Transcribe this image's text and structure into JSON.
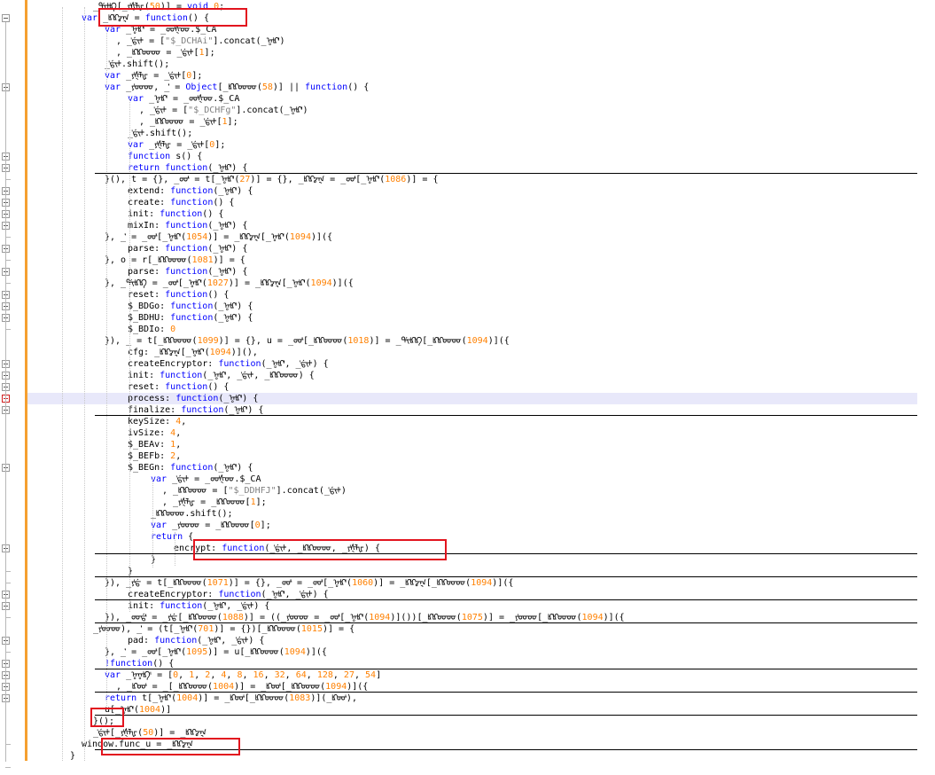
{
  "colors": {
    "keyword": "#0000ff",
    "number": "#ff8000",
    "string": "#808080",
    "default": "#000000",
    "change_margin": "#f5a030",
    "highlight_box": "#e2141e",
    "current_line": "#e8e8fa"
  },
  "code_lines": [
    {
      "indent": 5,
      "segs": [
        [
          "def",
          "_ᡩᡳᡰᡌ[_ᠶᡃᡧᡀ("
        ],
        [
          "num",
          "50"
        ],
        [
          "def",
          ")] = "
        ],
        [
          "kw",
          "void"
        ],
        [
          "def",
          " "
        ],
        [
          "num",
          "0"
        ],
        [
          "def",
          ";"
        ]
      ]
    },
    {
      "indent": 4,
      "segs": [
        [
          "kw",
          "var"
        ],
        [
          "def",
          " _ᡌᡌᡒᡎ = "
        ],
        [
          "kw",
          "function"
        ],
        [
          "def",
          "() {"
        ]
      ]
    },
    {
      "indent": 6,
      "segs": [
        [
          "kw",
          "var"
        ],
        [
          "def",
          " _ᡎᡌᡃᡃ = _ᡂᡃᡧᡂ.$_CA"
        ]
      ]
    },
    {
      "indent": 7,
      "segs": [
        [
          "def",
          ", _ᡃᡩᡳᡰ = ["
        ],
        [
          "str",
          "\"$_DCHAi\""
        ],
        [
          "def",
          "].concat(_ᡎᡌᡃᡃ)"
        ]
      ]
    },
    {
      "indent": 7,
      "segs": [
        [
          "def",
          ", _ᡌᡌᡂᡂ = _ᡃᡩᡳᡰ["
        ],
        [
          "num",
          "1"
        ],
        [
          "def",
          "];"
        ]
      ]
    },
    {
      "indent": 6,
      "segs": [
        [
          "def",
          "_ᡃᡩᡳᡰ.shift();"
        ]
      ]
    },
    {
      "indent": 6,
      "segs": [
        [
          "kw",
          "var"
        ],
        [
          "def",
          " _ᠶᡃᡧᡀ = _ᡃᡩᡳᡰ["
        ],
        [
          "num",
          "0"
        ],
        [
          "def",
          "];"
        ]
      ]
    },
    {
      "indent": 6,
      "segs": [
        [
          "kw",
          "var"
        ],
        [
          "def",
          " _ᠶᡃᡂᡂ, _ᡃᡃᡃᡃ = "
        ],
        [
          "kw",
          "Object"
        ],
        [
          "def",
          "[_ᡌᡌᡂᡂ("
        ],
        [
          "num",
          "58"
        ],
        [
          "def",
          ")] || "
        ],
        [
          "kw",
          "function"
        ],
        [
          "def",
          "() {"
        ]
      ]
    },
    {
      "indent": 8,
      "segs": [
        [
          "kw",
          "var"
        ],
        [
          "def",
          " _ᡎᡌᡃᡃ = _ᡂᡃᡧᡂ.$_CA"
        ]
      ]
    },
    {
      "indent": 9,
      "segs": [
        [
          "def",
          ", _ᡃᡩᡳᡰ = ["
        ],
        [
          "str",
          "\"$_DCHFg\""
        ],
        [
          "def",
          "].concat(_ᡎᡌᡃᡃ)"
        ]
      ]
    },
    {
      "indent": 9,
      "segs": [
        [
          "def",
          ", _ᡌᡌᡂᡂ = _ᡃᡩᡳᡰ["
        ],
        [
          "num",
          "1"
        ],
        [
          "def",
          "];"
        ]
      ]
    },
    {
      "indent": 8,
      "segs": [
        [
          "def",
          "_ᡃᡩᡳᡰ.shift();"
        ]
      ]
    },
    {
      "indent": 8,
      "segs": [
        [
          "kw",
          "var"
        ],
        [
          "def",
          " _ᠶᡃᡧᡀ = _ᡃᡩᡳᡰ["
        ],
        [
          "num",
          "0"
        ],
        [
          "def",
          "];"
        ]
      ]
    },
    {
      "indent": 8,
      "segs": [
        [
          "kw",
          "function"
        ],
        [
          "def",
          " s() {"
        ]
      ]
    },
    {
      "indent": 8,
      "segs": [
        [
          "kw",
          "return"
        ],
        [
          "def",
          " "
        ],
        [
          "kw",
          "function"
        ],
        [
          "def",
          "(_ᡎᡌᡃᡃ) {"
        ]
      ]
    },
    {
      "indent": 6,
      "segs": [
        [
          "def",
          "}(), t = {}, _ᡂᡃᡃᡃ = t[_ᡎᡌᡃᡃ("
        ],
        [
          "num",
          "27"
        ],
        [
          "def",
          ")] = {}, _ᡌᡌᡒᡎ = _ᡂᡃᡃᡃ[_ᡎᡌᡃᡃ("
        ],
        [
          "num",
          "1086"
        ],
        [
          "def",
          ")] = {"
        ]
      ]
    },
    {
      "indent": 8,
      "segs": [
        [
          "def",
          "extend: "
        ],
        [
          "kw",
          "function"
        ],
        [
          "def",
          "(_ᡎᡌᡃᡃ) {"
        ]
      ]
    },
    {
      "indent": 8,
      "segs": [
        [
          "def",
          "create: "
        ],
        [
          "kw",
          "function"
        ],
        [
          "def",
          "() {"
        ]
      ]
    },
    {
      "indent": 8,
      "segs": [
        [
          "def",
          "init: "
        ],
        [
          "kw",
          "function"
        ],
        [
          "def",
          "() {"
        ]
      ]
    },
    {
      "indent": 8,
      "segs": [
        [
          "def",
          "mixIn: "
        ],
        [
          "kw",
          "function"
        ],
        [
          "def",
          "(_ᡎᡌᡃᡃ) {"
        ]
      ]
    },
    {
      "indent": 6,
      "segs": [
        [
          "def",
          "}, _ᡃᡃᡃᡃ = _ᡂᡃᡃᡃ[_ᡎᡌᡃᡃ("
        ],
        [
          "num",
          "1054"
        ],
        [
          "def",
          ")] = _ᡌᡌᡒᡎ[_ᡎᡌᡃᡃ("
        ],
        [
          "num",
          "1094"
        ],
        [
          "def",
          ")]({"
        ]
      ]
    },
    {
      "indent": 8,
      "segs": [
        [
          "def",
          "parse: "
        ],
        [
          "kw",
          "function"
        ],
        [
          "def",
          "(_ᡎᡌᡃᡃ) {"
        ]
      ]
    },
    {
      "indent": 6,
      "segs": [
        [
          "def",
          "}, o = r[_ᡌᡌᡂᡂ("
        ],
        [
          "num",
          "1081"
        ],
        [
          "def",
          ")] = {"
        ]
      ]
    },
    {
      "indent": 8,
      "segs": [
        [
          "def",
          "parse: "
        ],
        [
          "kw",
          "function"
        ],
        [
          "def",
          "(_ᡎᡌᡃᡃ) {"
        ]
      ]
    },
    {
      "indent": 6,
      "segs": [
        [
          "def",
          "}, _ᡩᡳᡌᡌ = _ᡂᡃᡃᡃ[_ᡎᡌᡃᡃ("
        ],
        [
          "num",
          "1027"
        ],
        [
          "def",
          ")] = _ᡌᡌᡒᡎ[_ᡎᡌᡃᡃ("
        ],
        [
          "num",
          "1094"
        ],
        [
          "def",
          ")]({"
        ]
      ]
    },
    {
      "indent": 8,
      "segs": [
        [
          "def",
          "reset: "
        ],
        [
          "kw",
          "function"
        ],
        [
          "def",
          "() {"
        ]
      ]
    },
    {
      "indent": 8,
      "segs": [
        [
          "def",
          "$_BDGo: "
        ],
        [
          "kw",
          "function"
        ],
        [
          "def",
          "(_ᡎᡌᡃᡃ) {"
        ]
      ]
    },
    {
      "indent": 8,
      "segs": [
        [
          "def",
          "$_BDHU: "
        ],
        [
          "kw",
          "function"
        ],
        [
          "def",
          "(_ᡎᡌᡃᡃ) {"
        ]
      ]
    },
    {
      "indent": 8,
      "segs": [
        [
          "def",
          "$_BDIo: "
        ],
        [
          "num",
          "0"
        ]
      ]
    },
    {
      "indent": 6,
      "segs": [
        [
          "def",
          "}), _ = t[_ᡌᡌᡂᡂ("
        ],
        [
          "num",
          "1099"
        ],
        [
          "def",
          ")] = {}, u = _ᡂᡃᡃᡃ[_ᡌᡌᡂᡂ("
        ],
        [
          "num",
          "1018"
        ],
        [
          "def",
          ")] = _ᡩᡳᡌᡌ[_ᡌᡌᡂᡂ("
        ],
        [
          "num",
          "1094"
        ],
        [
          "def",
          ")]({"
        ]
      ]
    },
    {
      "indent": 8,
      "segs": [
        [
          "def",
          "cfg: _ᡌᡌᡒᡎ[_ᡎᡌᡃᡃ("
        ],
        [
          "num",
          "1094"
        ],
        [
          "def",
          ")](),"
        ]
      ]
    },
    {
      "indent": 8,
      "segs": [
        [
          "def",
          "createEncryptor: "
        ],
        [
          "kw",
          "function"
        ],
        [
          "def",
          "(_ᡎᡌᡃᡃ, _ᡃᡩᡳᡰ) {"
        ]
      ]
    },
    {
      "indent": 8,
      "segs": [
        [
          "def",
          "init: "
        ],
        [
          "kw",
          "function"
        ],
        [
          "def",
          "(_ᡎᡌᡃᡃ, _ᡃᡩᡳᡰ, _ᡌᡌᡂᡂ) {"
        ]
      ]
    },
    {
      "indent": 8,
      "segs": [
        [
          "def",
          "reset: "
        ],
        [
          "kw",
          "function"
        ],
        [
          "def",
          "() {"
        ]
      ]
    },
    {
      "indent": 8,
      "segs": [
        [
          "def",
          "process: "
        ],
        [
          "kw",
          "function"
        ],
        [
          "def",
          "(_ᡎᡌᡃᡃ) {"
        ]
      ]
    },
    {
      "indent": 8,
      "segs": [
        [
          "def",
          "finalize: "
        ],
        [
          "kw",
          "function"
        ],
        [
          "def",
          "(_ᡎᡌᡃᡃ) {"
        ]
      ]
    },
    {
      "indent": 8,
      "segs": [
        [
          "def",
          "keySize: "
        ],
        [
          "num",
          "4"
        ],
        [
          "def",
          ","
        ]
      ]
    },
    {
      "indent": 8,
      "segs": [
        [
          "def",
          "ivSize: "
        ],
        [
          "num",
          "4"
        ],
        [
          "def",
          ","
        ]
      ]
    },
    {
      "indent": 8,
      "segs": [
        [
          "def",
          "$_BEAv: "
        ],
        [
          "num",
          "1"
        ],
        [
          "def",
          ","
        ]
      ]
    },
    {
      "indent": 8,
      "segs": [
        [
          "def",
          "$_BEFb: "
        ],
        [
          "num",
          "2"
        ],
        [
          "def",
          ","
        ]
      ]
    },
    {
      "indent": 8,
      "segs": [
        [
          "def",
          "$_BEGn: "
        ],
        [
          "kw",
          "function"
        ],
        [
          "def",
          "(_ᡎᡌᡃᡃ) {"
        ]
      ]
    },
    {
      "indent": 10,
      "segs": [
        [
          "kw",
          "var"
        ],
        [
          "def",
          " _ᡃᡩᡳᡰ = _ᡂᡃᡧᡂ.$_CA"
        ]
      ]
    },
    {
      "indent": 11,
      "segs": [
        [
          "def",
          ", _ᡌᡌᡂᡂ = ["
        ],
        [
          "str",
          "\"$_DDHFJ\""
        ],
        [
          "def",
          "].concat(_ᡃᡩᡳᡰ)"
        ]
      ]
    },
    {
      "indent": 11,
      "segs": [
        [
          "def",
          ", _ᠶᡃᡧᡀ = _ᡌᡌᡂᡂ["
        ],
        [
          "num",
          "1"
        ],
        [
          "def",
          "];"
        ]
      ]
    },
    {
      "indent": 10,
      "segs": [
        [
          "def",
          "_ᡌᡌᡂᡂ.shift();"
        ]
      ]
    },
    {
      "indent": 10,
      "segs": [
        [
          "kw",
          "var"
        ],
        [
          "def",
          " _ᠶᡃᡂᡂ = _ᡌᡌᡂᡂ["
        ],
        [
          "num",
          "0"
        ],
        [
          "def",
          "];"
        ]
      ]
    },
    {
      "indent": 10,
      "segs": [
        [
          "kw",
          "return"
        ],
        [
          "def",
          " {"
        ]
      ]
    },
    {
      "indent": 12,
      "segs": [
        [
          "def",
          "encrypt: "
        ],
        [
          "kw",
          "function"
        ],
        [
          "def",
          "(_ᡃᡩᡳᡰ, _ᡌᡌᡂᡂ, _ᠶᡃᡧᡀ) {"
        ]
      ]
    },
    {
      "indent": 10,
      "segs": [
        [
          "def",
          "}"
        ]
      ]
    },
    {
      "indent": 8,
      "segs": [
        [
          "def",
          "}"
        ]
      ]
    },
    {
      "indent": 6,
      "segs": [
        [
          "def",
          "}), _ᠶᡃᡩ = t[_ᡌᡌᡂᡂ("
        ],
        [
          "num",
          "1071"
        ],
        [
          "def",
          ")] = {}, _ᡂᡃᡃᡃ = _ᡂᡃᡃᡃ[_ᡎᡌᡃᡃ("
        ],
        [
          "num",
          "1060"
        ],
        [
          "def",
          ")] = _ᡌᡌᡒᡎ[_ᡌᡌᡂᡂ("
        ],
        [
          "num",
          "1094"
        ],
        [
          "def",
          ")]({"
        ]
      ]
    },
    {
      "indent": 8,
      "segs": [
        [
          "def",
          "createEncryptor: "
        ],
        [
          "kw",
          "function"
        ],
        [
          "def",
          "(_ᡎᡌᡃᡃ, _ᡃᡩᡳᡰ) {"
        ]
      ]
    },
    {
      "indent": 8,
      "segs": [
        [
          "def",
          "init: "
        ],
        [
          "kw",
          "function"
        ],
        [
          "def",
          "(_ᡎᡌᡃᡃ, _ᡃᡩᡳᡰ) {"
        ]
      ]
    },
    {
      "indent": 6,
      "segs": [
        [
          "def",
          "}), _ᡂᡩᡃᡃ = _ᠶᡃᡩ[_ᡌᡌᡂᡂ("
        ],
        [
          "num",
          "1088"
        ],
        [
          "def",
          ")] = ((_ᠶᡃᡂᡂ = _ᡂᡃᡃᡃ[_ᡎᡌᡃᡃ("
        ],
        [
          "num",
          "1094"
        ],
        [
          "def",
          ")]())[_ᡌᡌᡂᡂ("
        ],
        [
          "num",
          "1075"
        ],
        [
          "def",
          ")] = _ᠶᡃᡂᡂ[_ᡌᡌᡂᡂ("
        ],
        [
          "num",
          "1094"
        ],
        [
          "def",
          ")]({"
        ]
      ]
    },
    {
      "indent": 5,
      "segs": [
        [
          "def",
          "_ᠶᡃᡂᡂ), _ᡃᡃᡃᡃ = (t[_ᡎᡌᡃᡃ("
        ],
        [
          "num",
          "701"
        ],
        [
          "def",
          ")] = {})[_ᡌᡌᡂᡂ("
        ],
        [
          "num",
          "1015"
        ],
        [
          "def",
          ")] = {"
        ]
      ]
    },
    {
      "indent": 8,
      "segs": [
        [
          "def",
          "pad: "
        ],
        [
          "kw",
          "function"
        ],
        [
          "def",
          "(_ᡎᡌᡃᡃ, _ᡃᡩᡳᡰ) {"
        ]
      ]
    },
    {
      "indent": 6,
      "segs": [
        [
          "def",
          "}, _ᡃᡃᡃᡃ = _ᡂᡃᡃᡃ[_ᡎᡌᡃᡃ("
        ],
        [
          "num",
          "1095"
        ],
        [
          "def",
          ")] = u[_ᡌᡌᡂᡂ("
        ],
        [
          "num",
          "1094"
        ],
        [
          "def",
          ")]({"
        ]
      ]
    },
    {
      "indent": 6,
      "segs": [
        [
          "kw",
          "!function"
        ],
        [
          "def",
          "() {"
        ]
      ]
    },
    {
      "indent": 6,
      "segs": [
        [
          "kw",
          "var"
        ],
        [
          "def",
          " _ᡎᡎᡌᡃ = ["
        ],
        [
          "num",
          "0"
        ],
        [
          "def",
          ", "
        ],
        [
          "num",
          "1"
        ],
        [
          "def",
          ", "
        ],
        [
          "num",
          "2"
        ],
        [
          "def",
          ", "
        ],
        [
          "num",
          "4"
        ],
        [
          "def",
          ", "
        ],
        [
          "num",
          "8"
        ],
        [
          "def",
          ", "
        ],
        [
          "num",
          "16"
        ],
        [
          "def",
          ", "
        ],
        [
          "num",
          "32"
        ],
        [
          "def",
          ", "
        ],
        [
          "num",
          "64"
        ],
        [
          "def",
          ", "
        ],
        [
          "num",
          "128"
        ],
        [
          "def",
          ", "
        ],
        [
          "num",
          "27"
        ],
        [
          "def",
          ", "
        ],
        [
          "num",
          "54"
        ],
        [
          "def",
          "]"
        ]
      ]
    },
    {
      "indent": 7,
      "segs": [
        [
          "def",
          ", _ᡌᡂᡃ = _[_ᡌᡌᡂᡂ("
        ],
        [
          "num",
          "1004"
        ],
        [
          "def",
          ")] = _ᡌᡂᡃ[_ᡌᡌᡂᡂ("
        ],
        [
          "num",
          "1094"
        ],
        [
          "def",
          ")]({"
        ]
      ]
    },
    {
      "indent": 6,
      "segs": [
        [
          "kw",
          "return"
        ],
        [
          "def",
          " t[_ᡎᡌᡃᡃ("
        ],
        [
          "num",
          "1004"
        ],
        [
          "def",
          ")] = _ᡌᡂᡃ[_ᡌᡌᡂᡂ("
        ],
        [
          "num",
          "1083"
        ],
        [
          "def",
          ")](_ᡌᡂᡃ),"
        ]
      ]
    },
    {
      "indent": 6,
      "segs": [
        [
          "def",
          "u[_ᡎᡌᡃᡃ("
        ],
        [
          "num",
          "1004"
        ],
        [
          "def",
          ")]"
        ]
      ]
    },
    {
      "indent": 5,
      "segs": [
        [
          "def",
          "}();"
        ]
      ]
    },
    {
      "indent": 5,
      "segs": [
        [
          "def",
          "_ᡃᡩᡳᡰ[_ᠶᡃᡧᡀ("
        ],
        [
          "num",
          "50"
        ],
        [
          "def",
          ")] = _ᡌᡌᡒᡎ"
        ]
      ]
    },
    {
      "indent": 4,
      "segs": [
        [
          "def",
          "window.func_u = _ᡌᡌᡒᡎ"
        ]
      ]
    },
    {
      "indent": 3,
      "segs": [
        [
          "def",
          "}"
        ]
      ]
    }
  ]
}
